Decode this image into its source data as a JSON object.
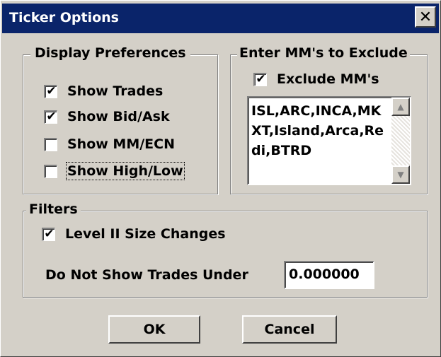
{
  "window": {
    "title": "Ticker Options",
    "close_glyph": "✕"
  },
  "display_prefs": {
    "title": "Display Preferences",
    "items": [
      {
        "label": "Show Trades",
        "checked": true
      },
      {
        "label": "Show Bid/Ask",
        "checked": true
      },
      {
        "label": "Show MM/ECN",
        "checked": false
      },
      {
        "label": "Show High/Low",
        "checked": false
      }
    ]
  },
  "exclude": {
    "title": "Enter MM's to Exclude",
    "checkbox_label": "Exclude MM's",
    "checked": true,
    "list_value": "ISL,ARC,INCA,MKXT,Island,Arca,Redi,BTRD"
  },
  "filters": {
    "title": "Filters",
    "level2_label": "Level II Size Changes",
    "level2_checked": true,
    "trades_under_label": "Do Not Show Trades Under",
    "trades_under_value": "0.000000"
  },
  "buttons": {
    "ok": "OK",
    "cancel": "Cancel"
  },
  "icons": {
    "check": "check-mark-icon",
    "close": "close-icon",
    "scroll_up": "scroll-up-arrow-icon",
    "scroll_down": "scroll-down-arrow-icon"
  },
  "colors": {
    "titlebar": "#0a246a",
    "dialog_bg": "#d4d0c8"
  }
}
